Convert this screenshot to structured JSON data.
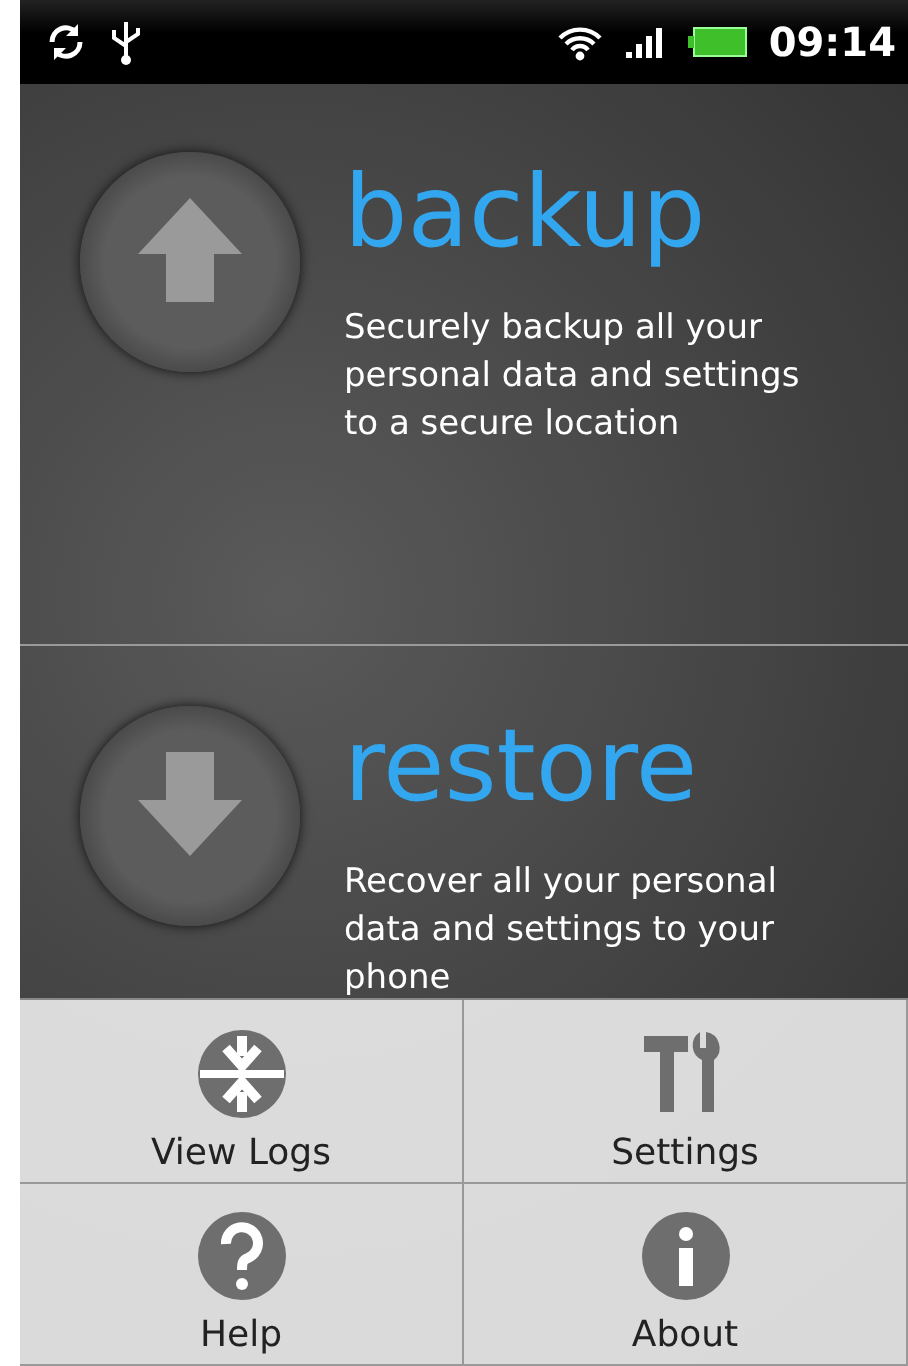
{
  "status_bar": {
    "time": "09:14"
  },
  "sections": [
    {
      "kind": "backup",
      "title": "backup",
      "description": "Securely backup all your personal data and settings to a secure location"
    },
    {
      "kind": "restore",
      "title": "restore",
      "description": "Recover all your personal data and settings to your phone"
    }
  ],
  "menu": [
    {
      "kind": "logs",
      "label": "View Logs"
    },
    {
      "kind": "settings",
      "label": "Settings"
    },
    {
      "kind": "help",
      "label": "Help"
    },
    {
      "kind": "about",
      "label": "About"
    }
  ]
}
